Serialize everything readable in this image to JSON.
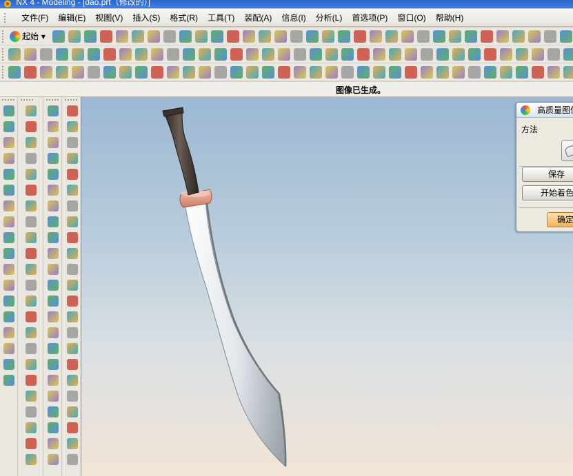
{
  "window": {
    "title": "NX 4 - Modeling - [dao.prt（修改的）]"
  },
  "menubar": {
    "items": [
      {
        "label": "文件(F)"
      },
      {
        "label": "编辑(E)"
      },
      {
        "label": "视图(V)"
      },
      {
        "label": "插入(S)"
      },
      {
        "label": "格式(R)"
      },
      {
        "label": "工具(T)"
      },
      {
        "label": "装配(A)"
      },
      {
        "label": "信息(I)"
      },
      {
        "label": "分析(L)"
      },
      {
        "label": "首选项(P)"
      },
      {
        "label": "窗口(O)"
      },
      {
        "label": "帮助(H)"
      }
    ]
  },
  "toolbar": {
    "start_label": "起始"
  },
  "status": {
    "message": "图像已生成。"
  },
  "dialog": {
    "title": "高质量图像",
    "method_label": "方法",
    "save_label": "保存",
    "start_shading_label": "开始着色",
    "ok_label": "确定"
  },
  "colors": {
    "viewport_top": "#9cb8d3",
    "viewport_bottom": "#f3e5d8",
    "blade": "#dfe5ea",
    "handle": "#4a3f38",
    "guard": "#e39a85"
  }
}
